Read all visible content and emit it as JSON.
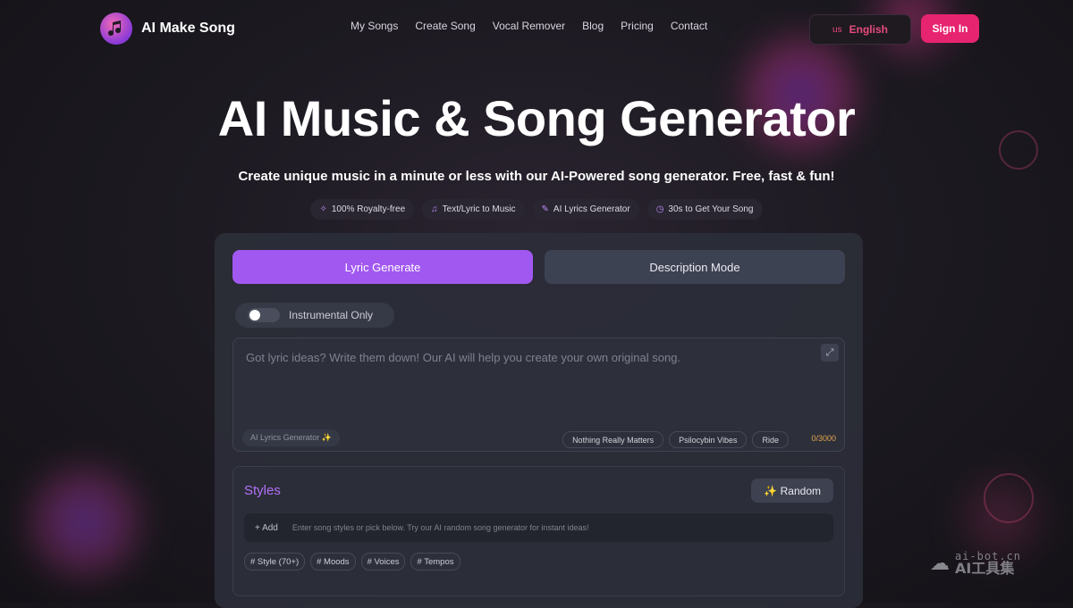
{
  "header": {
    "brand": "AI Make Song",
    "nav": [
      "My Songs",
      "Create Song",
      "Vocal Remover",
      "Blog",
      "Pricing",
      "Contact"
    ],
    "language": {
      "flag": "us",
      "label": "English"
    },
    "signin_label": "Sign In"
  },
  "hero": {
    "title": "AI Music & Song Generator",
    "subtitle": "Create unique music in a minute or less with our AI-Powered song generator. Free, fast & fun!",
    "features": [
      {
        "icon": "sparkles-icon",
        "label": "100% Royalty-free"
      },
      {
        "icon": "music-note-icon",
        "label": "Text/Lyric to Music"
      },
      {
        "icon": "pen-icon",
        "label": "AI Lyrics Generator"
      },
      {
        "icon": "stopwatch-icon",
        "label": "30s to Get Your Song"
      }
    ]
  },
  "generator": {
    "tabs": [
      {
        "label": "Lyric Generate",
        "active": true
      },
      {
        "label": "Description Mode",
        "active": false
      }
    ],
    "instrumental_label": "Instrumental Only",
    "instrumental_on": false,
    "lyrics": {
      "placeholder": "Got lyric ideas? Write them down! Our AI will help you create your own original song.",
      "value": "",
      "ai_button": "AI Lyrics Generator ✨",
      "suggestions": [
        "Nothing Really Matters",
        "Psilocybin Vibes",
        "Ride"
      ],
      "counter": "0/3000"
    },
    "styles": {
      "title": "Styles",
      "random_label": "✨ Random",
      "add_label": "+ Add",
      "placeholder": "Enter song styles or pick below. Try our AI random song generator for instant ideas!",
      "chips": [
        "# Style  (70+)",
        "# Moods",
        "# Voices",
        "# Tempos"
      ]
    }
  },
  "watermark": {
    "url": "ai-bot.cn",
    "name": "AI工具集"
  },
  "colors": {
    "accent": "#a158f0",
    "signin": "#e6246f",
    "counter": "#e3a24c"
  }
}
